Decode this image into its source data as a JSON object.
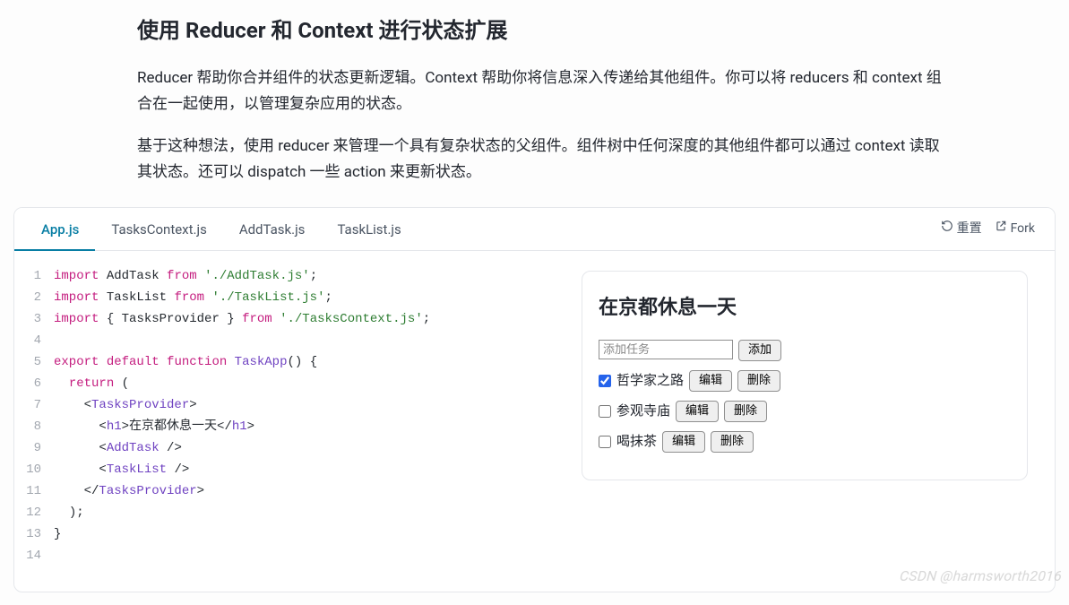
{
  "article": {
    "heading": "使用 Reducer 和 Context 进行状态扩展",
    "para1": "Reducer 帮助你合并组件的状态更新逻辑。Context 帮助你将信息深入传递给其他组件。你可以将 reducers 和 context 组合在一起使用，以管理复杂应用的状态。",
    "para2": "基于这种想法，使用 reducer 来管理一个具有复杂状态的父组件。组件树中任何深度的其他组件都可以通过 context 读取其状态。还可以 dispatch 一些 action 来更新状态。"
  },
  "sandbox": {
    "tabs": [
      "App.js",
      "TasksContext.js",
      "AddTask.js",
      "TaskList.js"
    ],
    "active_tab": 0,
    "actions": {
      "reset": "重置",
      "fork": "Fork"
    },
    "code_lines": [
      {
        "n": "1",
        "tokens": [
          [
            "kw",
            "import"
          ],
          [
            "sp",
            " "
          ],
          [
            "var",
            "AddTask"
          ],
          [
            "sp",
            " "
          ],
          [
            "kw",
            "from"
          ],
          [
            "sp",
            " "
          ],
          [
            "str",
            "'./AddTask.js'"
          ],
          [
            "punct",
            ";"
          ]
        ]
      },
      {
        "n": "2",
        "tokens": [
          [
            "kw",
            "import"
          ],
          [
            "sp",
            " "
          ],
          [
            "var",
            "TaskList"
          ],
          [
            "sp",
            " "
          ],
          [
            "kw",
            "from"
          ],
          [
            "sp",
            " "
          ],
          [
            "str",
            "'./TaskList.js'"
          ],
          [
            "punct",
            ";"
          ]
        ]
      },
      {
        "n": "3",
        "tokens": [
          [
            "kw",
            "import"
          ],
          [
            "sp",
            " "
          ],
          [
            "punct",
            "{ "
          ],
          [
            "var",
            "TasksProvider"
          ],
          [
            "punct",
            " }"
          ],
          [
            "sp",
            " "
          ],
          [
            "kw",
            "from"
          ],
          [
            "sp",
            " "
          ],
          [
            "str",
            "'./TasksContext.js'"
          ],
          [
            "punct",
            ";"
          ]
        ]
      },
      {
        "n": "4",
        "tokens": []
      },
      {
        "n": "5",
        "tokens": [
          [
            "kw",
            "export"
          ],
          [
            "sp",
            " "
          ],
          [
            "kw",
            "default"
          ],
          [
            "sp",
            " "
          ],
          [
            "kw",
            "function"
          ],
          [
            "sp",
            " "
          ],
          [
            "fn",
            "TaskApp"
          ],
          [
            "punct",
            "()"
          ],
          [
            "sp",
            " "
          ],
          [
            "brace",
            "{"
          ]
        ]
      },
      {
        "n": "6",
        "tokens": [
          [
            "sp",
            "  "
          ],
          [
            "kw",
            "return"
          ],
          [
            "sp",
            " "
          ],
          [
            "punct",
            "("
          ]
        ]
      },
      {
        "n": "7",
        "tokens": [
          [
            "sp",
            "    "
          ],
          [
            "punct",
            "<"
          ],
          [
            "comp",
            "TasksProvider"
          ],
          [
            "punct",
            ">"
          ]
        ]
      },
      {
        "n": "8",
        "tokens": [
          [
            "sp",
            "      "
          ],
          [
            "punct",
            "<"
          ],
          [
            "htmltag",
            "h1"
          ],
          [
            "punct",
            ">"
          ],
          [
            "text",
            "在京都休息一天"
          ],
          [
            "punct",
            "</"
          ],
          [
            "htmltag",
            "h1"
          ],
          [
            "punct",
            ">"
          ]
        ]
      },
      {
        "n": "9",
        "tokens": [
          [
            "sp",
            "      "
          ],
          [
            "punct",
            "<"
          ],
          [
            "comp",
            "AddTask"
          ],
          [
            "sp",
            " "
          ],
          [
            "punct",
            "/>"
          ]
        ]
      },
      {
        "n": "10",
        "tokens": [
          [
            "sp",
            "      "
          ],
          [
            "punct",
            "<"
          ],
          [
            "comp",
            "TaskList"
          ],
          [
            "sp",
            " "
          ],
          [
            "punct",
            "/>"
          ]
        ]
      },
      {
        "n": "11",
        "tokens": [
          [
            "sp",
            "    "
          ],
          [
            "punct",
            "</"
          ],
          [
            "comp",
            "TasksProvider"
          ],
          [
            "punct",
            ">"
          ]
        ]
      },
      {
        "n": "12",
        "tokens": [
          [
            "sp",
            "  "
          ],
          [
            "punct",
            ");"
          ]
        ]
      },
      {
        "n": "13",
        "tokens": [
          [
            "brace",
            "}"
          ]
        ]
      },
      {
        "n": "14",
        "tokens": []
      }
    ]
  },
  "preview": {
    "title": "在京都休息一天",
    "add_placeholder": "添加任务",
    "add_btn": "添加",
    "edit_btn": "编辑",
    "delete_btn": "删除",
    "tasks": [
      {
        "text": "哲学家之路",
        "done": true
      },
      {
        "text": "参观寺庙",
        "done": false
      },
      {
        "text": "喝抹茶",
        "done": false
      }
    ]
  },
  "watermark": "CSDN @harmsworth2016"
}
